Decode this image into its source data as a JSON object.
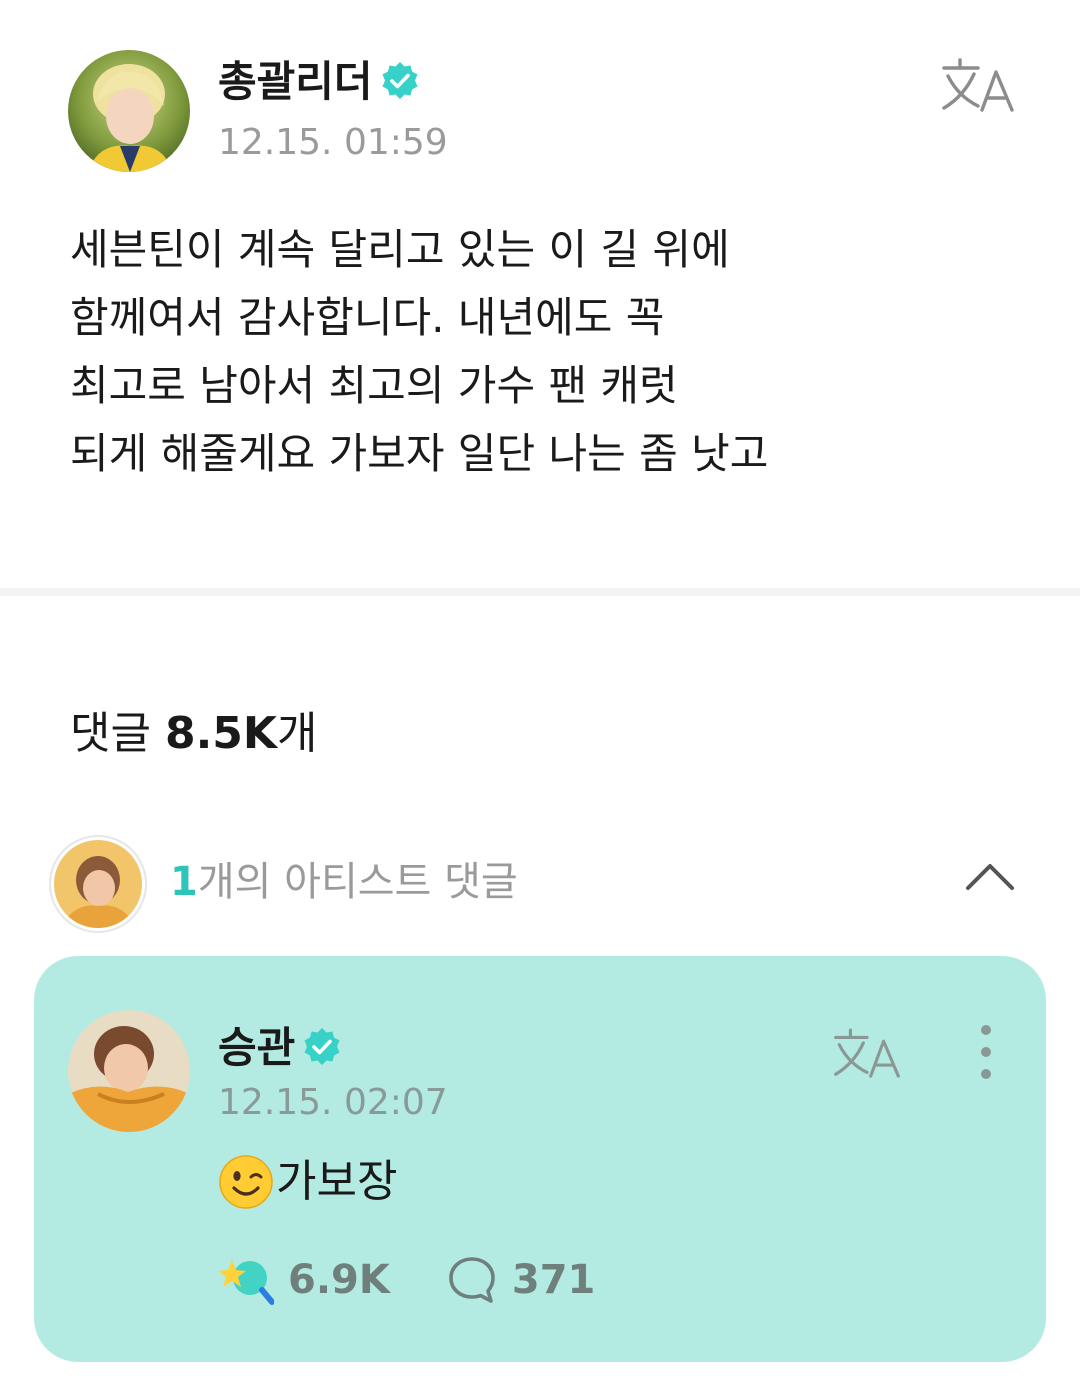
{
  "post": {
    "author": "총괄리더",
    "timestamp": "12.15. 01:59",
    "body": "세븐틴이 계속 달리고 있는 이 길 위에\n함께여서 감사합니다. 내년에도 꼭\n최고로 남아서 최고의 가수 팬 캐럿\n되게 해줄게요 가보자 일단 나는 좀 낫고",
    "icons": {
      "verified": "verified-badge-icon",
      "translate": "translate-icon"
    }
  },
  "comments": {
    "label": "댓글",
    "count": "8.5K",
    "suffix": "개"
  },
  "artist_comments": {
    "count": "1",
    "label": "개의 아티스트 댓글",
    "icons": {
      "toggle": "chevron-up-icon"
    }
  },
  "artist_comment": {
    "author": "승관",
    "timestamp": "12.15. 02:07",
    "text": "가보장",
    "emoji": "winking-face",
    "likes": "6.9K",
    "replies": "371",
    "icons": {
      "like": "sparkle-heart-icon",
      "reply": "speech-bubble-icon",
      "more": "more-vertical-icon",
      "translate": "translate-icon"
    }
  },
  "colors": {
    "accent": "#2cc4bb",
    "verified": "#38d1c8",
    "card_background": "#b3ebe2",
    "muted_text": "#9a9a9a"
  }
}
